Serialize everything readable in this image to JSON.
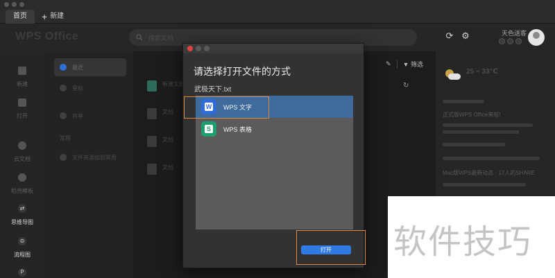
{
  "tabs": {
    "home": "首页",
    "new": "新建"
  },
  "header": {
    "logo": "WPS Office",
    "search_placeholder": "搜索文档",
    "weather_label": "天色送客"
  },
  "sidebar": {
    "items": [
      {
        "label": "新建",
        "icon": "new-icon"
      },
      {
        "label": "打开",
        "icon": "open-icon"
      },
      {
        "label": "云文档",
        "icon": "cloud-icon"
      },
      {
        "label": "稻壳模板",
        "icon": "template-icon"
      },
      {
        "label": "思维导图",
        "icon": "mindmap-icon"
      },
      {
        "label": "流程图",
        "icon": "flowchart-icon"
      }
    ]
  },
  "nav2": {
    "items": [
      {
        "label": "最近"
      },
      {
        "label": "星标"
      },
      {
        "label": "共享"
      }
    ],
    "section": "常用",
    "hint": "文件夹添加到常用"
  },
  "file_list": [
    {
      "name": "新建文档",
      "sub": ""
    },
    {
      "name": "文档",
      "sub": ""
    },
    {
      "name": "文档",
      "sub": ""
    },
    {
      "name": "文档",
      "sub": ""
    }
  ],
  "toolbar": {
    "filter": "筛选"
  },
  "right_panel": {
    "temp": "25 ~ 33℃",
    "news_title": "正式版WPS Office来啦!",
    "news_title2": "Mac版WPS最新动态 · 17人的SHARE"
  },
  "dialog": {
    "title": "请选择打开文件的方式",
    "file_name": "武极天下.txt",
    "apps": [
      {
        "label": "WPS 文字",
        "icon_letter": "W",
        "icon_color": "#2f6bd9"
      },
      {
        "label": "WPS 表格",
        "icon_letter": "S",
        "icon_color": "#1d9e6e"
      }
    ],
    "open_button": "打开"
  },
  "watermark": "软件技巧",
  "colors": {
    "accent": "#2f7ae5",
    "highlight": "#e08a3c",
    "selected_row": "#3f6a9c"
  }
}
